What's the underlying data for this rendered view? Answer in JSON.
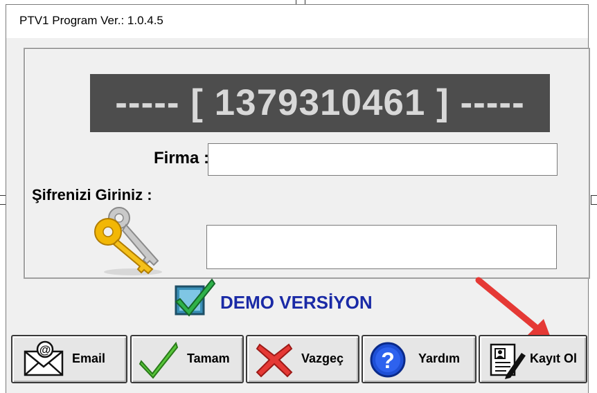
{
  "window": {
    "title": "PTV1 Program Ver.: 1.0.4.5"
  },
  "panel": {
    "serial_display": "----- [ 1379310461 ] -----",
    "firma_label": "Firma :",
    "firma_value": "",
    "password_label": "Şifrenizi Giriniz :",
    "password_value": ""
  },
  "demo": {
    "text": "DEMO VERSİYON",
    "color": "#1a2aa6"
  },
  "buttons": {
    "email": "Email",
    "tamam": "Tamam",
    "vazgec": "Vazgeç",
    "yardim": "Yardım",
    "kayit": "Kayıt Ol"
  },
  "icons": {
    "email": "envelope-at-icon",
    "tamam": "green-check-icon",
    "vazgec": "red-x-icon",
    "yardim": "blue-question-icon",
    "kayit": "registration-form-pen-icon",
    "key": "golden-key-icon",
    "demo": "check-box-icon"
  },
  "annotation": {
    "arrow_color": "#e53935"
  }
}
